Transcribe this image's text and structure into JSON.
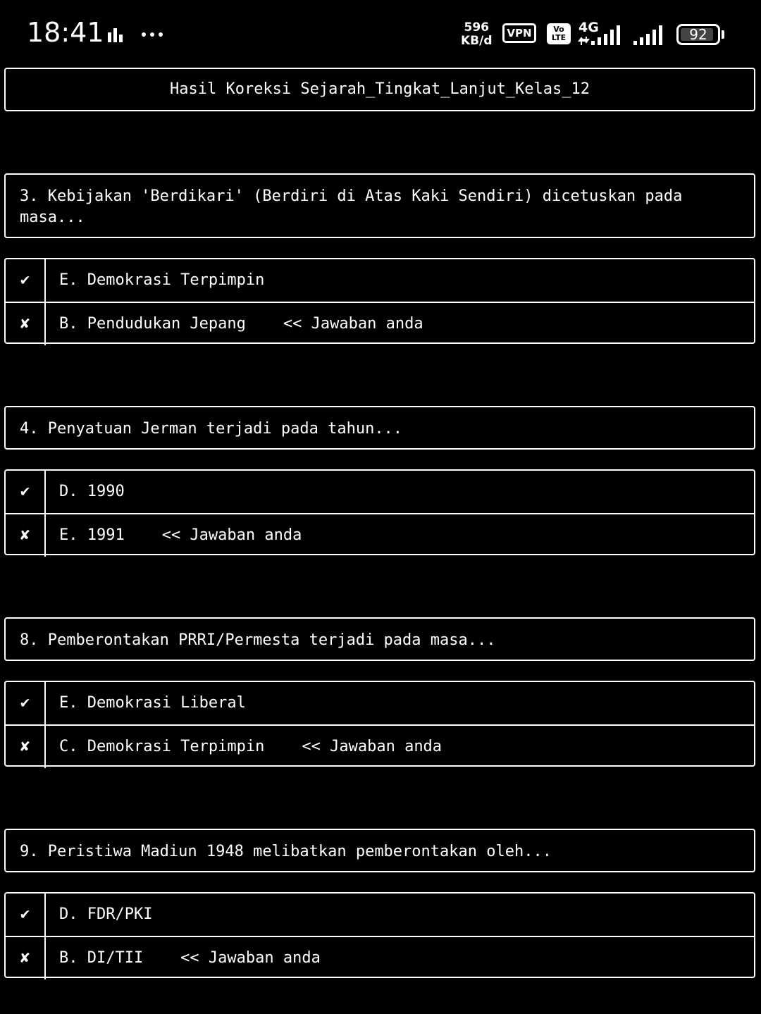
{
  "status_bar": {
    "time": "18:41",
    "speed_value": "596",
    "speed_unit": "KB/d",
    "vpn": "VPN",
    "volte_top": "Vo",
    "volte_bottom": "LTE",
    "network": "4G",
    "battery": "92",
    "battery_level": 0.92,
    "icons": [
      "activity-bars-icon",
      "more-dots-icon",
      "signal-icon",
      "signal-icon",
      "battery-icon"
    ]
  },
  "title": "Hasil Koreksi Sejarah_Tingkat_Lanjut_Kelas_12",
  "marks": {
    "correct": "✔",
    "wrong": "✘"
  },
  "questions": [
    {
      "text": "3. Kebijakan 'Berdikari' (Berdiri di Atas Kaki Sendiri) dicetuskan pada masa...",
      "correct": "E. Demokrasi Terpimpin",
      "wrong": "B. Pendudukan Jepang    << Jawaban anda"
    },
    {
      "text": "4. Penyatuan Jerman terjadi pada tahun...",
      "correct": "D. 1990",
      "wrong": "E. 1991    << Jawaban anda"
    },
    {
      "text": "8. Pemberontakan PRRI/Permesta terjadi pada masa...",
      "correct": "E. Demokrasi Liberal",
      "wrong": "C. Demokrasi Terpimpin    << Jawaban anda"
    },
    {
      "text": "9. Peristiwa Madiun 1948 melibatkan pemberontakan oleh...",
      "correct": "D. FDR/PKI",
      "wrong": "B. DI/TII    << Jawaban anda"
    }
  ]
}
